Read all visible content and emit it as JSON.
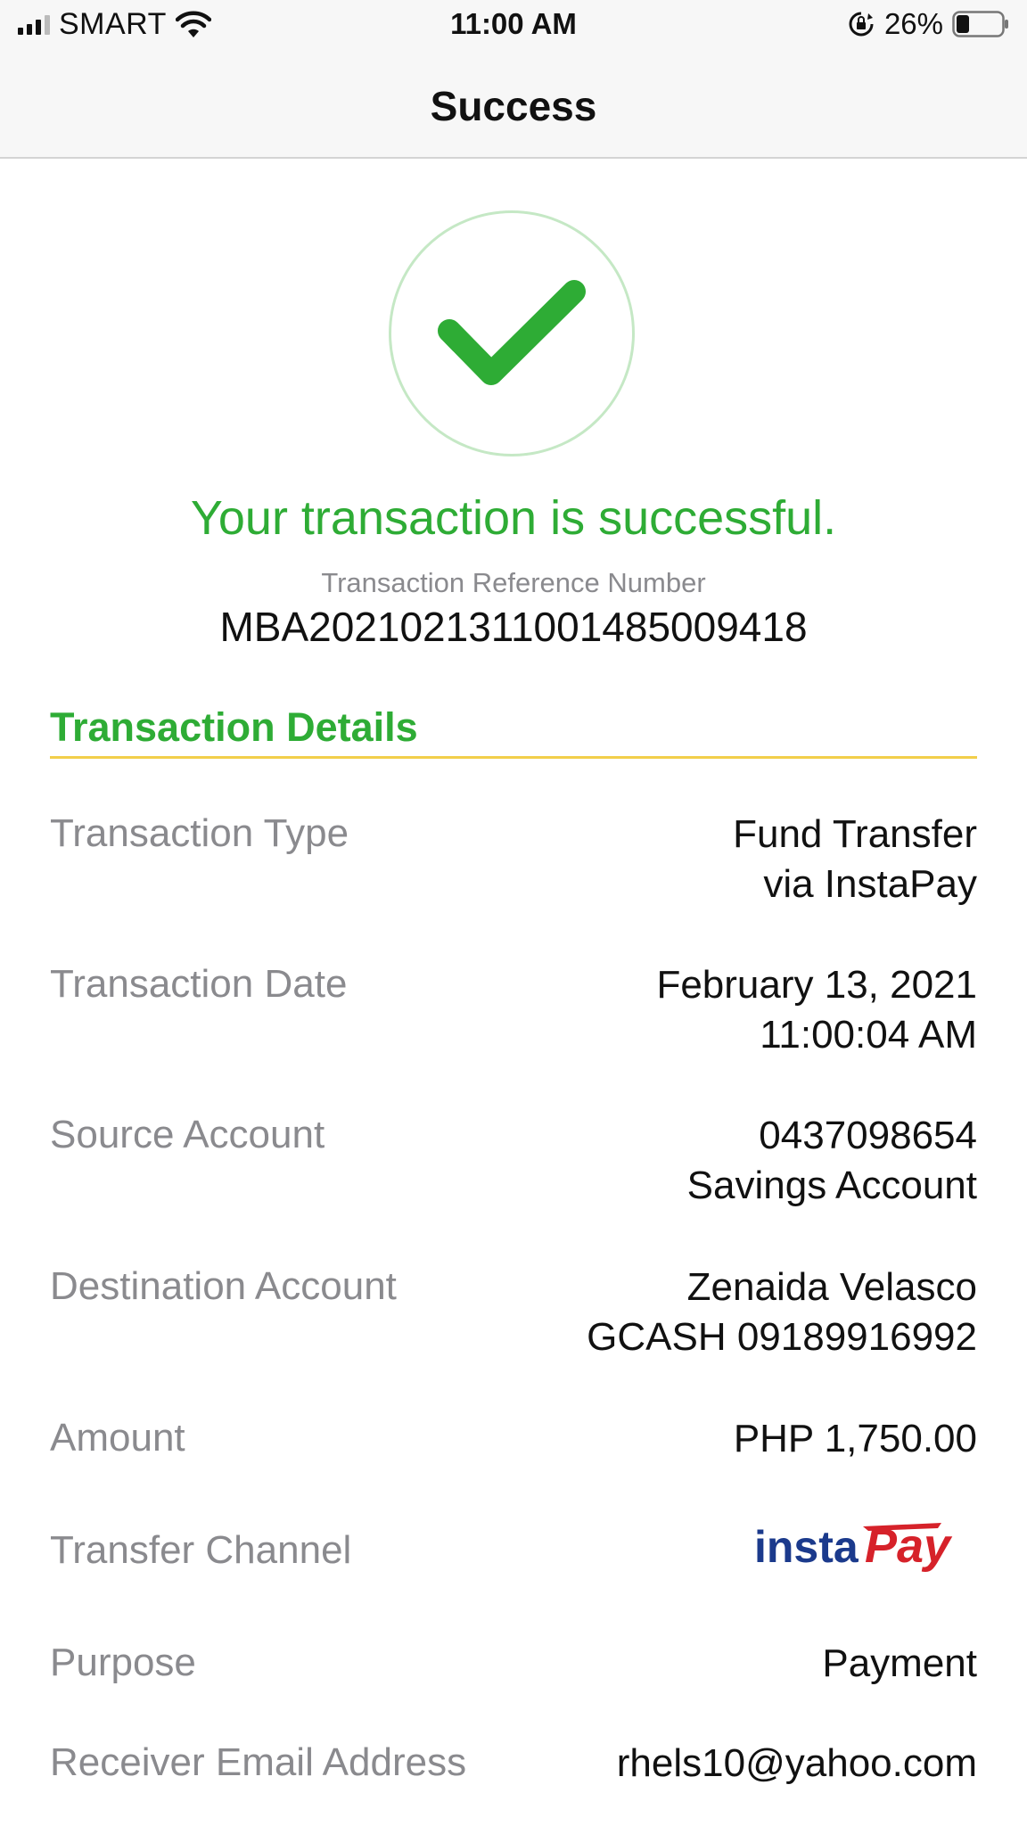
{
  "status_bar": {
    "carrier": "SMART",
    "time": "11:00 AM",
    "battery": "26%",
    "icons": [
      "signal-icon",
      "wifi-icon",
      "rotation-lock-icon",
      "battery-icon"
    ]
  },
  "nav": {
    "title": "Success"
  },
  "result": {
    "message": "Your transaction is successful.",
    "ref_label": "Transaction Reference Number",
    "ref_number": "MBA20210213110014850094​18"
  },
  "details": {
    "title": "Transaction Details",
    "rows": [
      {
        "label": "Transaction Type",
        "line1": "Fund Transfer",
        "line2": "via InstaPay"
      },
      {
        "label": "Transaction Date",
        "line1": "February 13, 2021",
        "line2": "11:00:04 AM"
      },
      {
        "label": "Source Account",
        "line1": "0437098654",
        "line2": "Savings Account"
      },
      {
        "label": "Destination Account",
        "line1": "Zenaida Velasco",
        "line2": "GCASH 09189916992"
      },
      {
        "label": "Amount",
        "line1": "PHP 1,750.00"
      },
      {
        "label": "Transfer Channel",
        "logo": "instaPay"
      },
      {
        "label": "Purpose",
        "line1": "Payment"
      },
      {
        "label": "Receiver Email Address",
        "line1": "rhels10@yahoo.com"
      }
    ]
  },
  "colors": {
    "accent_green": "#2eac35",
    "divider_yellow": "#f2cf4a",
    "label_gray": "#8a8a8e",
    "instapay_blue": "#1b3a8c",
    "instapay_red": "#d6222a"
  }
}
